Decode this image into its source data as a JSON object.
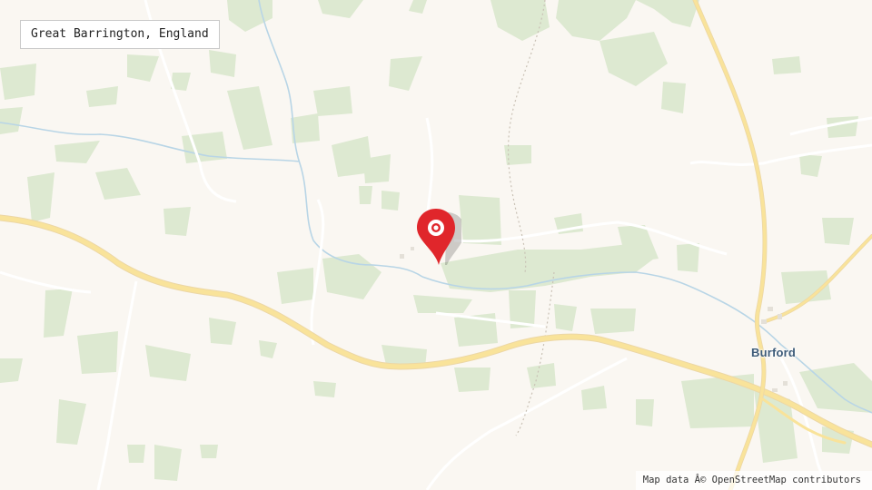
{
  "location_label": "Great Barrington, England",
  "places": {
    "burford": "Burford"
  },
  "attribution": "Map data Â© OpenStreetMap contributors",
  "marker": {
    "icon": "map-pin-icon",
    "color": "#e0262b"
  },
  "colors": {
    "land": "#faf7f2",
    "woodland": "#dbe9cf",
    "road_major": "#f7dc8f",
    "road_minor": "#ffffff",
    "water": "#a7cbe0",
    "path": "#c7bfb3"
  }
}
